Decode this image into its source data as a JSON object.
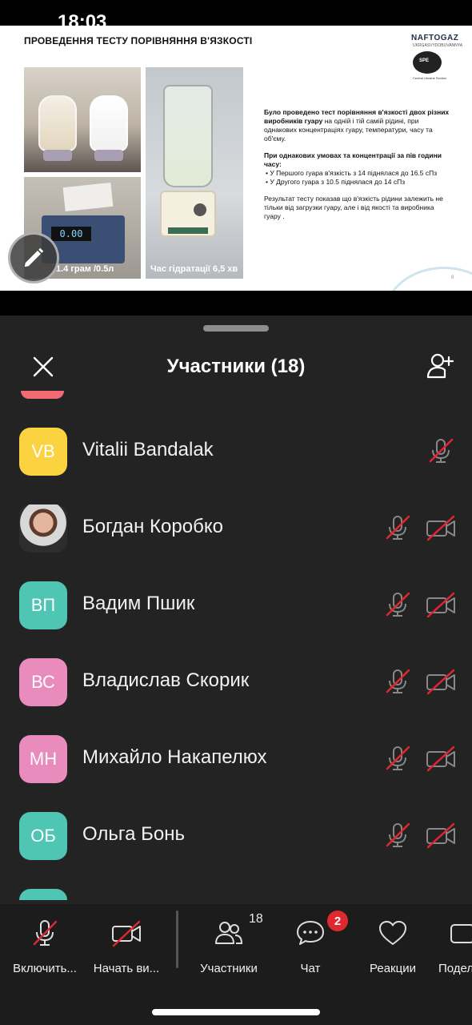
{
  "status": {
    "time": "18:03"
  },
  "slide": {
    "title": "ПРОВЕДЕННЯ ТЕСТУ ПОРІВНЯННЯ В'ЯЗКОСТІ",
    "logo": {
      "brand": "NAFTOGAZ",
      "sub": "UKRGASVYDOBUVANNYA",
      "spe": "SPE",
      "spe_sub": "Central Ukraine Section"
    },
    "scale_readout": "0.00",
    "caption_left": "1.4 грам /0.5л",
    "caption_right": "Час гідратації 6,5 хв",
    "p1_bold": "Було проведено тест порівняння в'язкості двох різних виробників гуару",
    "p1_rest": " на одній і тій самій рідині, при однакових концентраціях гуару, температури, часу  та об'єму.",
    "p2_bold": "При однакових умовах  та концентрації за пів години часу:",
    "bullet1": "•  У Першого гуара в'язкість з 14 піднялася до 16.5 сПз",
    "bullet2": "•  У Другого гуара з 10.5 піднялася до 14 сПз",
    "p3": "Результат тесту показав що в'язкість рідини залежить не тільки від загрузки гуару, але і від якості  та виробника гуару .",
    "page_no": "8"
  },
  "panel": {
    "title": "Участники (18)",
    "participants": [
      {
        "initials": "VB",
        "name": "Vitalii Bandalak",
        "color": "#fbd341",
        "mic_muted": true,
        "has_camera_icon": false,
        "photo": false
      },
      {
        "initials": "",
        "name": "Богдан Коробко",
        "color": "#6b4a3a",
        "mic_muted": true,
        "has_camera_icon": true,
        "photo": true
      },
      {
        "initials": "ВП",
        "name": "Вадим Пшик",
        "color": "#4fc5b4",
        "mic_muted": true,
        "has_camera_icon": true,
        "photo": false
      },
      {
        "initials": "ВС",
        "name": "Владислав Скорик",
        "color": "#e98bbd",
        "mic_muted": true,
        "has_camera_icon": true,
        "photo": false
      },
      {
        "initials": "МН",
        "name": "Михайло Накапелюх",
        "color": "#e98bbd",
        "mic_muted": true,
        "has_camera_icon": true,
        "photo": false
      },
      {
        "initials": "ОБ",
        "name": "Ольга Бонь",
        "color": "#4fc5b4",
        "mic_muted": true,
        "has_camera_icon": true,
        "photo": false
      }
    ]
  },
  "toolbar": {
    "unmute": "Включить...",
    "start_video": "Начать ви...",
    "participants": "Участники",
    "participants_count": "18",
    "chat": "Чат",
    "chat_badge": "2",
    "reactions": "Реакции",
    "share": "Подел"
  },
  "colors": {
    "panel_bg": "#232323",
    "toolbar_bg": "#1c1c1c",
    "muted_red": "#e0292f"
  }
}
